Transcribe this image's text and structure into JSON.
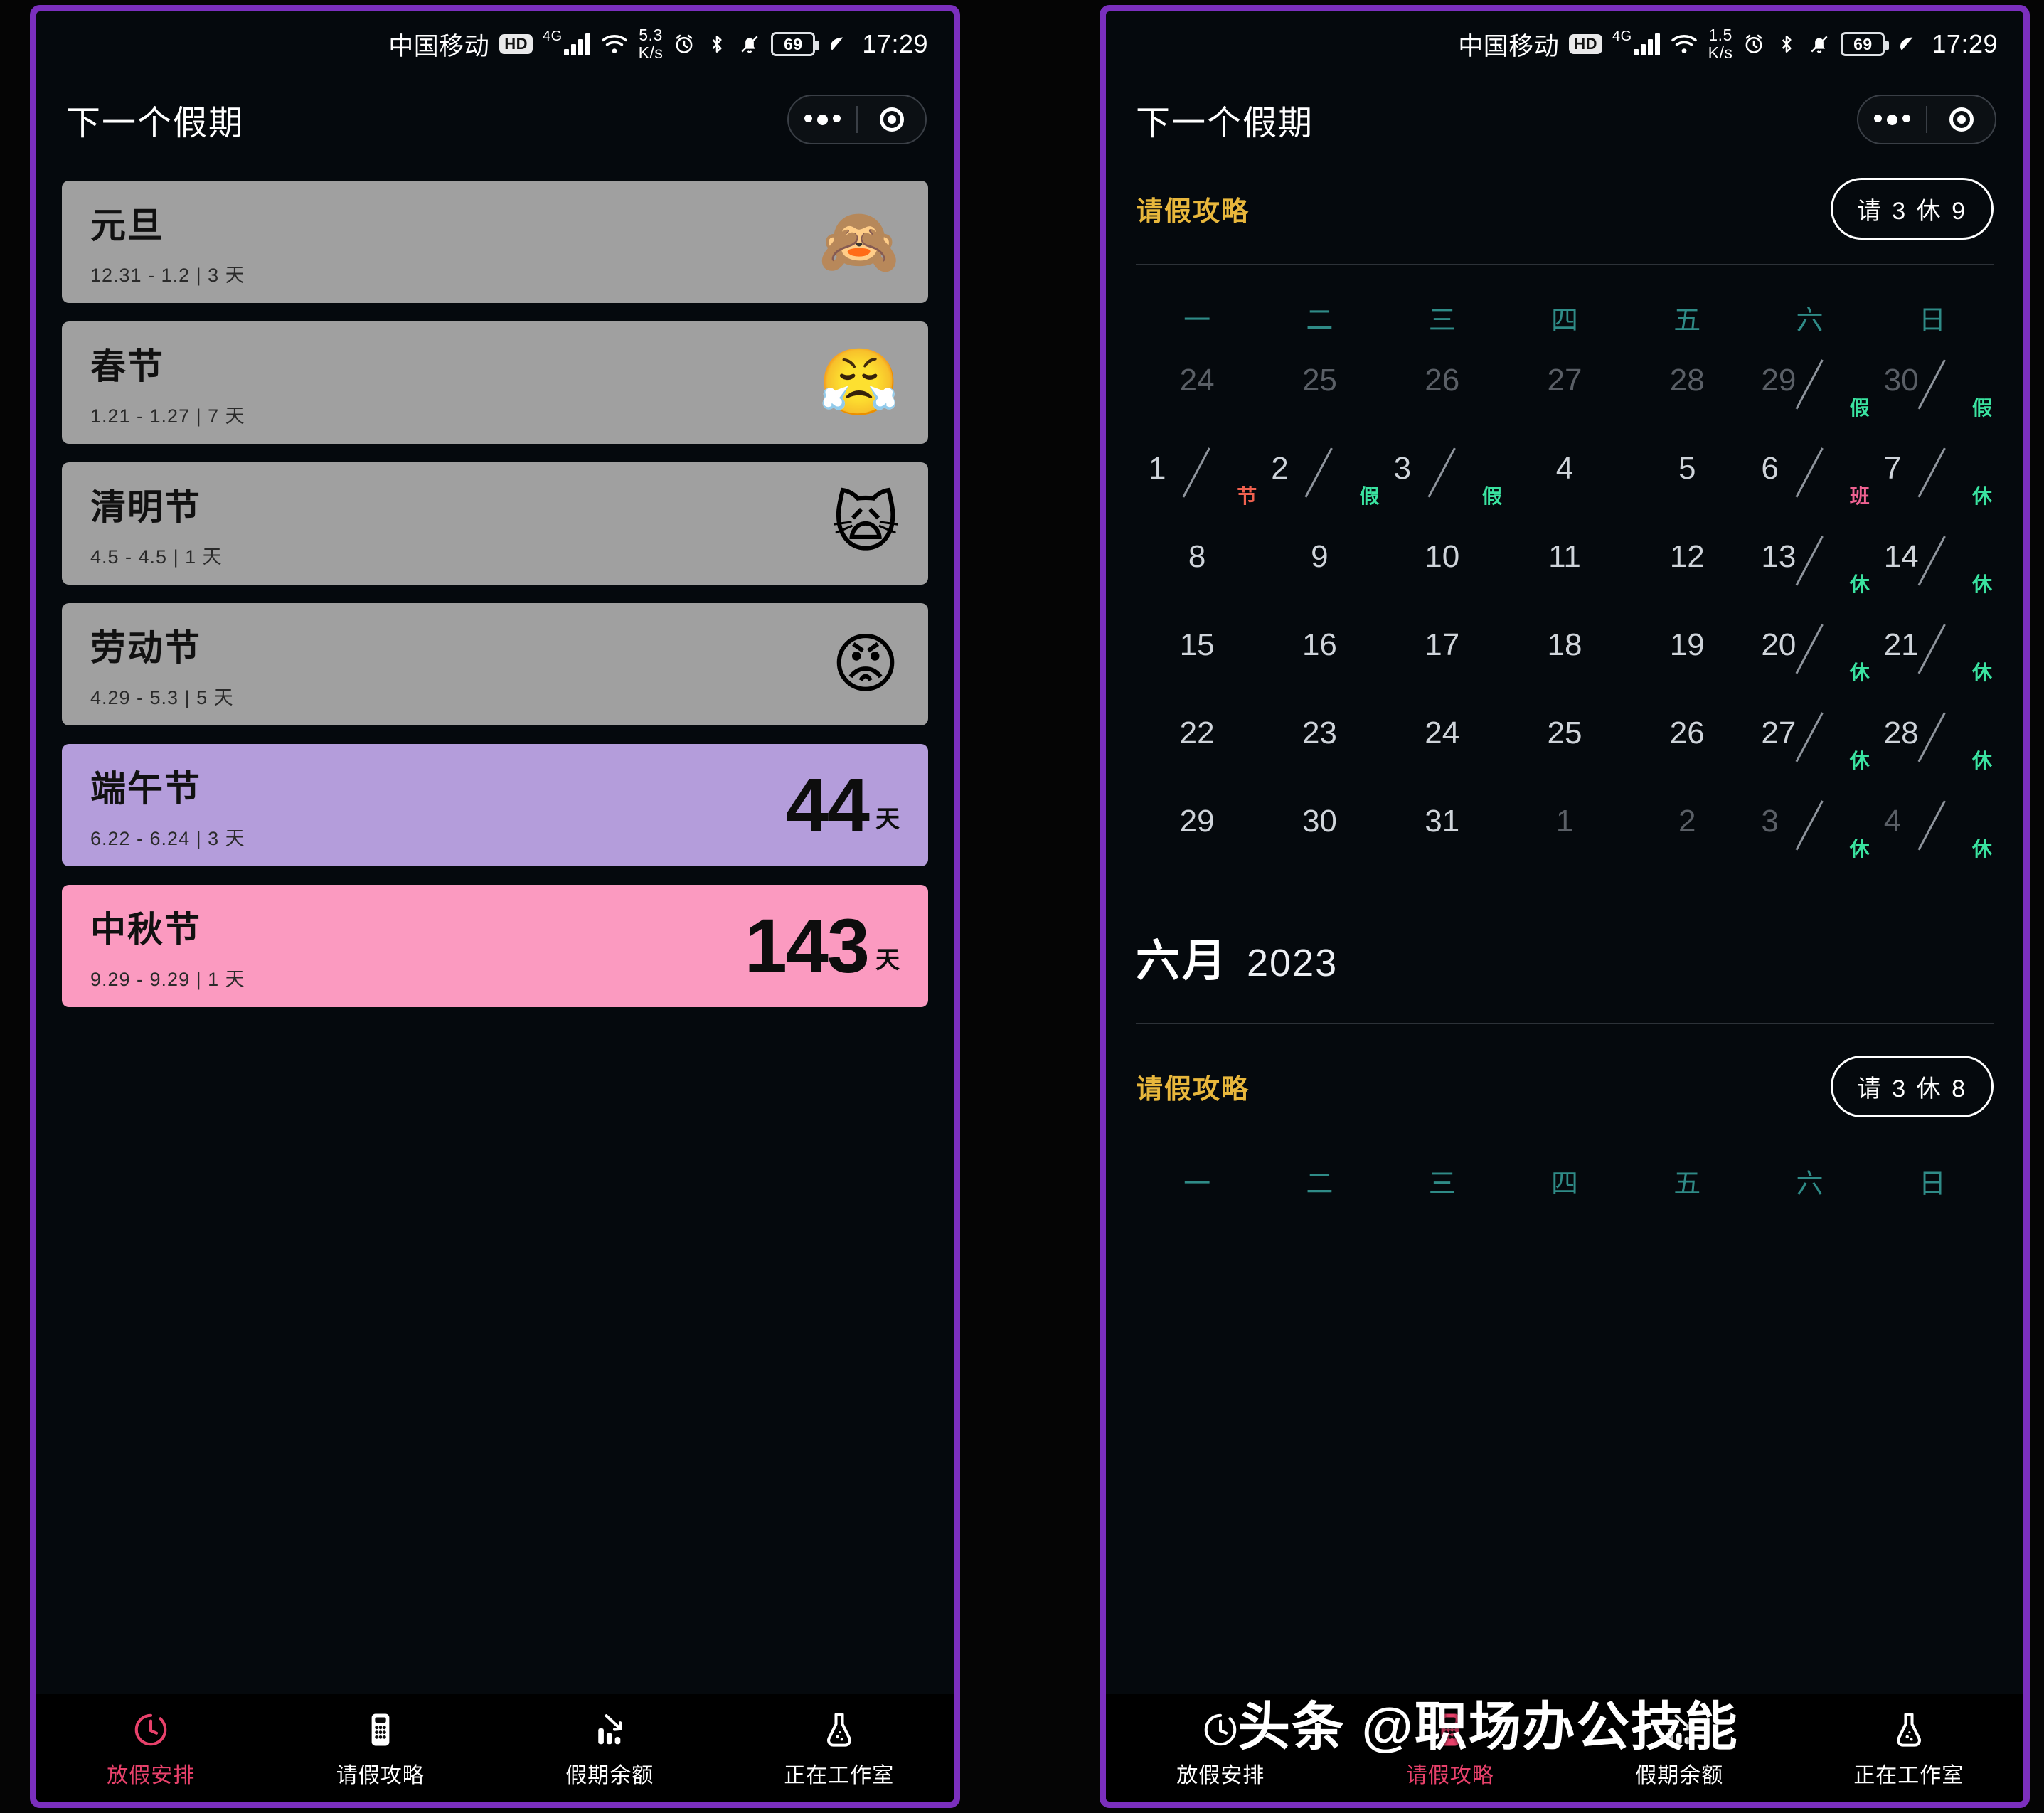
{
  "status_bar": {
    "carrier": "中国移动",
    "hd": "HD",
    "net_type": "4G",
    "speed_left": "5.3",
    "speed_right": "1.5",
    "speed_unit": "K/s",
    "battery": "69",
    "time": "17:29",
    "icons": [
      "alarm-icon",
      "bluetooth-icon",
      "bell-mute-icon",
      "battery-icon",
      "leaf-icon"
    ]
  },
  "app": {
    "title": "下一个假期",
    "capsule": {
      "menu_icon": "more-dots-icon",
      "close_icon": "target-icon"
    }
  },
  "holidays": [
    {
      "name": "元旦",
      "range": "12.31 - 1.2 | 3 天",
      "emoji": "🙈",
      "emoji_name": "see-no-evil-monkey-emoji",
      "bg": "#a0a0a0",
      "count": "",
      "unit": ""
    },
    {
      "name": "春节",
      "range": "1.21 - 1.27 | 7 天",
      "emoji": "😤",
      "emoji_name": "face-with-steam-emoji",
      "bg": "#a0a0a0",
      "count": "",
      "unit": ""
    },
    {
      "name": "清明节",
      "range": "4.5 - 4.5 | 1 天",
      "emoji": "🙀",
      "emoji_name": "weary-cat-emoji",
      "bg": "#a0a0a0",
      "count": "",
      "unit": ""
    },
    {
      "name": "劳动节",
      "range": "4.29 - 5.3 | 5 天",
      "emoji": "😡",
      "emoji_name": "pouting-face-emoji",
      "bg": "#a0a0a0",
      "count": "",
      "unit": ""
    },
    {
      "name": "端午节",
      "range": "6.22 - 6.24 | 3 天",
      "emoji": "",
      "emoji_name": "",
      "bg": "#b49ddb",
      "count": "44",
      "unit": "天"
    },
    {
      "name": "中秋节",
      "range": "9.29 - 9.29 | 1 天",
      "emoji": "",
      "emoji_name": "",
      "bg": "#fb9ac0",
      "count": "143",
      "unit": "天"
    }
  ],
  "tabbar": {
    "items": [
      {
        "label": "放假安排",
        "icon": "clock-icon"
      },
      {
        "label": "请假攻略",
        "icon": "calculator-icon"
      },
      {
        "label": "假期余额",
        "icon": "chart-down-icon"
      },
      {
        "label": "正在工作室",
        "icon": "flask-icon"
      }
    ],
    "active_left": 0,
    "active_right": 1
  },
  "strategy": {
    "title": "请假攻略",
    "badge_top": "请 3 休 9",
    "badge_bottom": "请 3 休 8",
    "title_color": "#e8b73c"
  },
  "calendar": {
    "weekdays": [
      "一",
      "二",
      "三",
      "四",
      "五",
      "六",
      "日"
    ],
    "month_cn": "六月",
    "year": "2023",
    "weeks": [
      [
        {
          "d": "24",
          "mark": "",
          "type": "",
          "muted": true
        },
        {
          "d": "25",
          "mark": "",
          "type": "",
          "muted": true
        },
        {
          "d": "26",
          "mark": "",
          "type": "",
          "muted": true
        },
        {
          "d": "27",
          "mark": "",
          "type": "",
          "muted": true
        },
        {
          "d": "28",
          "mark": "",
          "type": "",
          "muted": true
        },
        {
          "d": "29",
          "mark": "假",
          "type": "rest",
          "muted": true
        },
        {
          "d": "30",
          "mark": "假",
          "type": "rest",
          "muted": true
        }
      ],
      [
        {
          "d": "1",
          "mark": "节",
          "type": "fest",
          "muted": false
        },
        {
          "d": "2",
          "mark": "假",
          "type": "rest",
          "muted": false
        },
        {
          "d": "3",
          "mark": "假",
          "type": "rest",
          "muted": false
        },
        {
          "d": "4",
          "mark": "",
          "type": "",
          "muted": false
        },
        {
          "d": "5",
          "mark": "",
          "type": "",
          "muted": false
        },
        {
          "d": "6",
          "mark": "班",
          "type": "work",
          "muted": false
        },
        {
          "d": "7",
          "mark": "休",
          "type": "rest",
          "muted": false
        }
      ],
      [
        {
          "d": "8",
          "mark": "",
          "type": "",
          "muted": false
        },
        {
          "d": "9",
          "mark": "",
          "type": "",
          "muted": false
        },
        {
          "d": "10",
          "mark": "",
          "type": "",
          "muted": false
        },
        {
          "d": "11",
          "mark": "",
          "type": "",
          "muted": false
        },
        {
          "d": "12",
          "mark": "",
          "type": "",
          "muted": false
        },
        {
          "d": "13",
          "mark": "休",
          "type": "rest",
          "muted": false
        },
        {
          "d": "14",
          "mark": "休",
          "type": "rest",
          "muted": false
        }
      ],
      [
        {
          "d": "15",
          "mark": "",
          "type": "",
          "muted": false
        },
        {
          "d": "16",
          "mark": "",
          "type": "",
          "muted": false
        },
        {
          "d": "17",
          "mark": "",
          "type": "",
          "muted": false
        },
        {
          "d": "18",
          "mark": "",
          "type": "",
          "muted": false
        },
        {
          "d": "19",
          "mark": "",
          "type": "",
          "muted": false
        },
        {
          "d": "20",
          "mark": "休",
          "type": "rest",
          "muted": false
        },
        {
          "d": "21",
          "mark": "休",
          "type": "rest",
          "muted": false
        }
      ],
      [
        {
          "d": "22",
          "mark": "",
          "type": "",
          "muted": false
        },
        {
          "d": "23",
          "mark": "",
          "type": "",
          "muted": false
        },
        {
          "d": "24",
          "mark": "",
          "type": "",
          "muted": false
        },
        {
          "d": "25",
          "mark": "",
          "type": "",
          "muted": false
        },
        {
          "d": "26",
          "mark": "",
          "type": "",
          "muted": false
        },
        {
          "d": "27",
          "mark": "休",
          "type": "rest",
          "muted": false
        },
        {
          "d": "28",
          "mark": "休",
          "type": "rest",
          "muted": false
        }
      ],
      [
        {
          "d": "29",
          "mark": "",
          "type": "",
          "muted": false
        },
        {
          "d": "30",
          "mark": "",
          "type": "",
          "muted": false
        },
        {
          "d": "31",
          "mark": "",
          "type": "",
          "muted": false
        },
        {
          "d": "1",
          "mark": "",
          "type": "",
          "muted": true
        },
        {
          "d": "2",
          "mark": "",
          "type": "",
          "muted": true
        },
        {
          "d": "3",
          "mark": "休",
          "type": "rest",
          "muted": true
        },
        {
          "d": "4",
          "mark": "休",
          "type": "rest",
          "muted": true
        }
      ]
    ]
  },
  "watermark": {
    "text": "头条 @职场办公技能"
  },
  "colors": {
    "frame": "#7b2fbe",
    "screen_bg": "#05090d",
    "card_gray": "#a0a0a0",
    "card_purple": "#b49ddb",
    "card_pink": "#fb9ac0",
    "accent_pink": "#e8416b",
    "gold": "#e8b73c",
    "rest_green": "#3ae3a0",
    "festival_red": "#f0614f",
    "workday_pink": "#f06292",
    "weekday_teal": "#2f8b87"
  }
}
